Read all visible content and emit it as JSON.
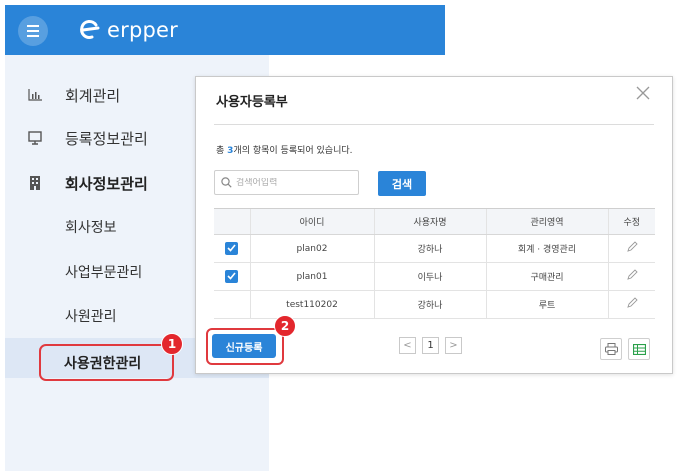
{
  "header": {
    "logo_text": "erpper",
    "menu_icon": "hamburger-icon"
  },
  "sidebar": {
    "items": [
      {
        "label": "회계관리",
        "icon": "bar-chart-icon"
      },
      {
        "label": "등록정보관리",
        "icon": "monitor-icon"
      },
      {
        "label": "회사정보관리",
        "icon": "building-icon"
      }
    ],
    "subitems": [
      "회사정보",
      "사업부문관리",
      "사원관리",
      "사용권한관리"
    ]
  },
  "badges": {
    "one": "1",
    "two": "2"
  },
  "modal": {
    "title": "사용자등록부",
    "count_prefix": "총 ",
    "count": "3",
    "count_suffix": "개의 항목이 등록되어 있습니다.",
    "search_placeholder": "검색어입력",
    "search_button": "검색",
    "columns": [
      "",
      "아이디",
      "사용자명",
      "관리영역",
      "수정"
    ],
    "rows": [
      {
        "checked": true,
        "id": "plan02",
        "name": "강하나",
        "area": "회계 · 경영관리"
      },
      {
        "checked": true,
        "id": "plan01",
        "name": "이두나",
        "area": "구매관리"
      },
      {
        "checked": false,
        "id": "test110202",
        "name": "강하나",
        "area": "루트"
      }
    ],
    "new_button": "신규등록",
    "pagination": {
      "prev": "<",
      "current": "1",
      "next": ">"
    },
    "icons": {
      "print": "printer-icon",
      "excel": "spreadsheet-icon"
    }
  },
  "colors": {
    "primary": "#2a84d8",
    "highlight": "#e0393e",
    "sidebar_bg": "#eef3fa"
  }
}
